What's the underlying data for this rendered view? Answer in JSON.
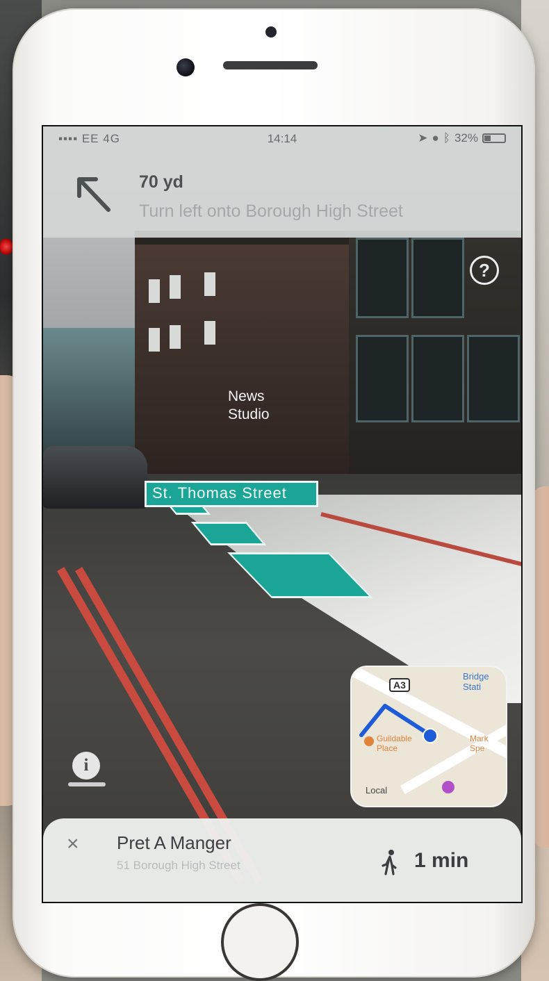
{
  "status_bar": {
    "carrier": "EE",
    "network": "4G",
    "time": "14:14",
    "battery_percent": "32%",
    "battery_level": 0.32
  },
  "navigation": {
    "distance": "70 yd",
    "instruction": "Turn left onto Borough High Street",
    "turn_icon": "arrow-up-left-icon"
  },
  "ar_view": {
    "poi_label": "News\nStudio",
    "street_label": "St. Thomas Street",
    "path_color": "#1aa597",
    "help_icon": "?",
    "info_icon": "i"
  },
  "mini_map": {
    "road_badge": "A3",
    "station_label": "Bridge Stati",
    "place_label": "Guildable Place",
    "market_label": "Mark Spe",
    "local_label": "Local",
    "route_color": "#1d5bd8"
  },
  "destination": {
    "name": "Pret A Manger",
    "address": "51 Borough High Street",
    "eta": "1 min",
    "close_icon": "×"
  }
}
